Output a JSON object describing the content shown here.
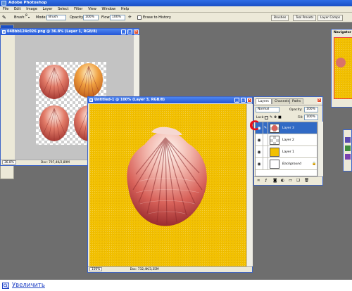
{
  "app": {
    "title": "Adobe Photoshop"
  },
  "menu": [
    "File",
    "Edit",
    "Image",
    "Layer",
    "Select",
    "Filter",
    "View",
    "Window",
    "Help"
  ],
  "options": {
    "brush_label": "Brush:",
    "brush_size": "8",
    "mode_label": "Mode:",
    "mode_value": "Brush",
    "opacity_label": "Opacity:",
    "opacity_value": "100%",
    "flow_label": "Flow:",
    "flow_value": "100%",
    "erase_history": "Erase to History",
    "well_tabs": [
      "Brushes",
      "Tool Presets",
      "Layer Comps"
    ]
  },
  "doc_shells": {
    "title": "04Bbb124c026.png @ 36.8% (Layer 1, RGB/8)",
    "zoom": "36.8%",
    "doc_info": "Doc: 797,4K/2,89M"
  },
  "doc_main": {
    "title": "Untitled-1 @ 100% (Layer 3, RGB/8)",
    "zoom": "100%",
    "doc_info": "Doc: 732,4K/3,35M"
  },
  "navigator": {
    "title": "Navigator"
  },
  "layers_panel": {
    "tabs": [
      "Layers",
      "Channels",
      "Paths"
    ],
    "blend_mode": "Normal",
    "opacity_label": "Opacity:",
    "opacity_value": "100%",
    "lock_label": "Lock:",
    "fill_label": "Fill:",
    "fill_value": "100%",
    "layers": [
      {
        "name": "Layer 3",
        "selected": true
      },
      {
        "name": "Layer 2",
        "selected": false
      },
      {
        "name": "Layer 1",
        "selected": false
      },
      {
        "name": "Background",
        "selected": false
      }
    ],
    "annotation_mark": "C"
  },
  "colors": {
    "accent_yellow": "#f2c000",
    "selection_blue": "#316ac5",
    "annotation_red": "#e8101a"
  },
  "footer": {
    "zoom_link": "Увеличить"
  }
}
